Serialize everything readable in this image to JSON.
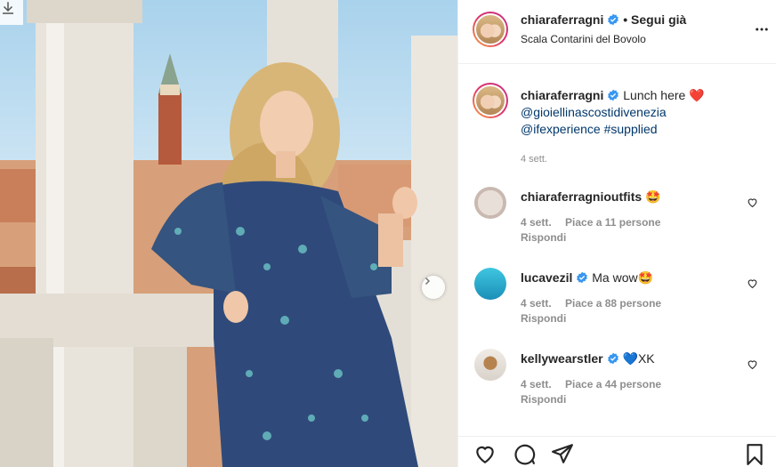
{
  "post": {
    "username": "chiaraferragni",
    "follow_label": "• Segui già",
    "location": "Scala Contarini del Bovolo"
  },
  "caption": {
    "username": "chiaraferragni",
    "text": "Lunch here",
    "emoji": "❤️",
    "mention1": "@gioiellinascostidivenezia",
    "mention2": "@ifexperience",
    "hashtag": "#supplied",
    "time": "4 sett."
  },
  "comments": [
    {
      "username": "chiaraferragnioutfits",
      "text": "🤩",
      "time": "4 sett.",
      "likes": "Piace a 11 persone",
      "reply": "Rispondi"
    },
    {
      "username": "lucavezil",
      "text": "Ma wow🤩",
      "time": "4 sett.",
      "likes": "Piace a 88 persone",
      "reply": "Rispondi"
    },
    {
      "username": "kellywearstler",
      "text": "💙XK",
      "time": "4 sett.",
      "likes": "Piace a 44 persone",
      "reply": "Rispondi"
    }
  ],
  "colors": {
    "verified": "#3897f0",
    "link": "#00376b",
    "muted": "#8e8e8e",
    "heart": "#ed4956"
  },
  "icons": [
    "download-icon",
    "next-arrow-icon",
    "more-icon",
    "heart-icon",
    "comment-icon",
    "share-icon",
    "bookmark-icon",
    "verified-icon"
  ]
}
